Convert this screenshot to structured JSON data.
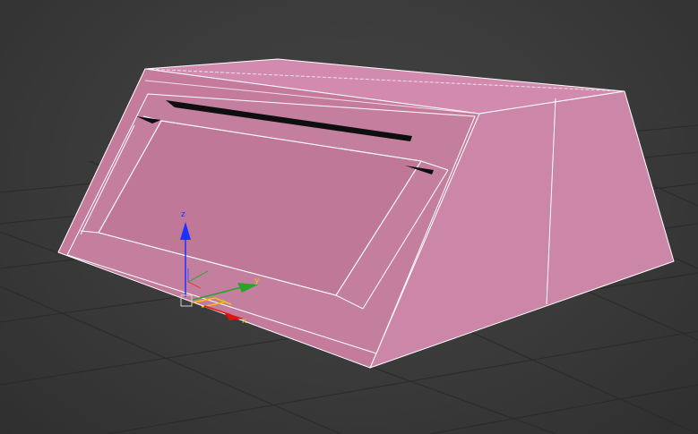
{
  "viewport": {
    "view": "Perspective",
    "background_color": "#3b3b3b",
    "grid_color": "#2a2a2a",
    "object_color": "#cc86a6",
    "edge_color": "#ffffff"
  },
  "gizmo": {
    "axes": [
      {
        "label": "z",
        "color": "#1e30ff"
      },
      {
        "label": "y",
        "color": "#2aa32a"
      },
      {
        "label": "x",
        "color": "#e01010"
      }
    ],
    "plane_color": "#f3c20e"
  }
}
